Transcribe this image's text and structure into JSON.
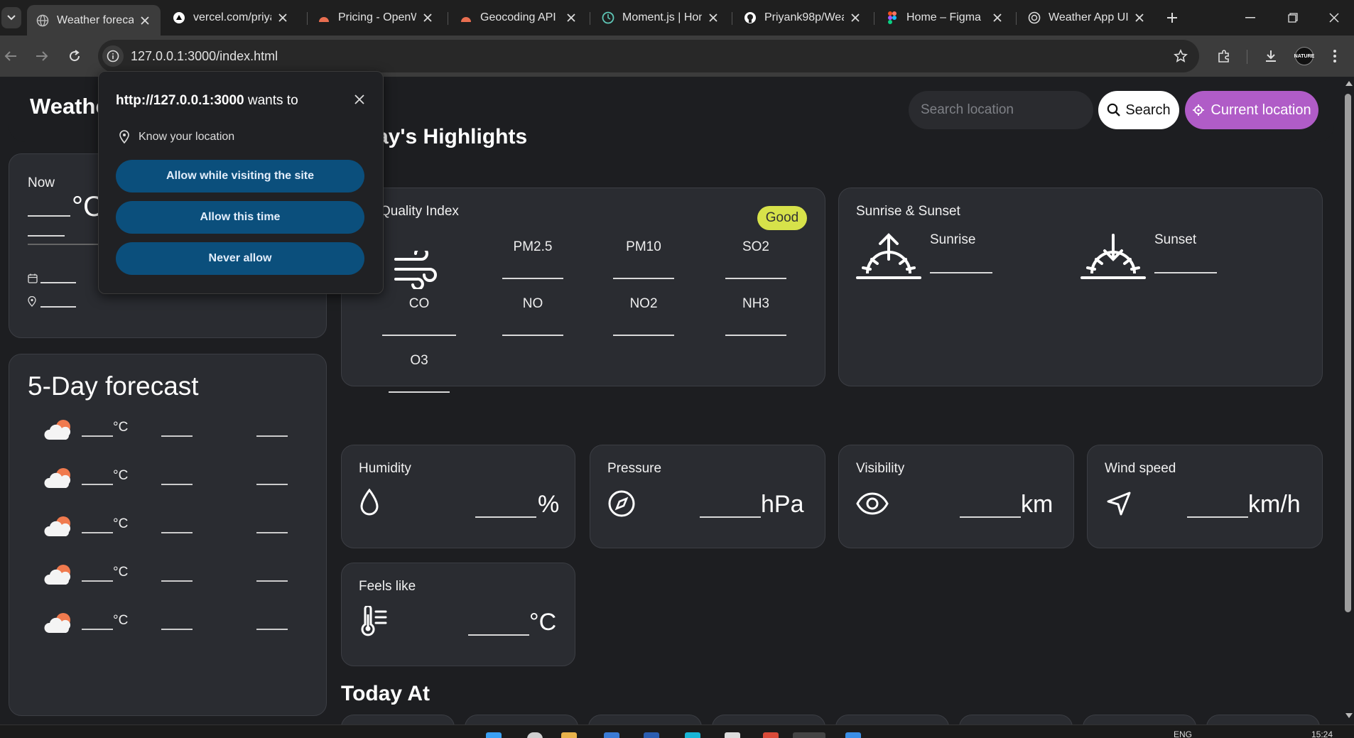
{
  "browser": {
    "tabs": [
      {
        "title": "Weather forecast",
        "active": true
      },
      {
        "title": "vercel.com/priya"
      },
      {
        "title": "Pricing - OpenW"
      },
      {
        "title": "Geocoding API -"
      },
      {
        "title": "Moment.js | Hon"
      },
      {
        "title": "Priyank98p/Wea"
      },
      {
        "title": "Home – Figma"
      },
      {
        "title": "Weather App UI"
      }
    ],
    "url": "127.0.0.1:3000/index.html",
    "profile_label": "NATURE"
  },
  "header": {
    "brand": "Weathe",
    "search_placeholder": "Search location",
    "search_label": "Search",
    "current_location_label": "Current location"
  },
  "permission_popup": {
    "origin": "http://127.0.0.1:3000",
    "suffix": " wants to",
    "request": "Know your location",
    "allow_visiting": "Allow while visiting the site",
    "allow_once": "Allow this time",
    "never": "Never allow"
  },
  "now_card": {
    "title": "Now",
    "temp_unit": "°C"
  },
  "forecast": {
    "title": "5-Day forecast",
    "rows": [
      {
        "unit": "°C"
      },
      {
        "unit": "°C"
      },
      {
        "unit": "°C"
      },
      {
        "unit": "°C"
      },
      {
        "unit": "°C"
      }
    ]
  },
  "highlights": {
    "title": "ay's Highlights",
    "aqi": {
      "title": "Quality Index",
      "badge": "Good",
      "labels": [
        "PM2.5",
        "PM10",
        "SO2",
        "CO",
        "NO",
        "NO2",
        "NH3",
        "O3"
      ]
    },
    "sun": {
      "title": "Sunrise & Sunset",
      "sunrise": "Sunrise",
      "sunset": "Sunset"
    },
    "humidity": {
      "title": "Humidity",
      "unit": "%"
    },
    "pressure": {
      "title": "Pressure",
      "unit": "hPa"
    },
    "visibility": {
      "title": "Visibility",
      "unit": "km"
    },
    "wind": {
      "title": "Wind speed",
      "unit": "km/h"
    },
    "feels": {
      "title": "Feels like",
      "unit": "°C"
    }
  },
  "today_at": {
    "title": "Today At"
  },
  "taskbar": {
    "lang": "ENG",
    "time": "15:24"
  },
  "colors": {
    "accent": "#b05cc7",
    "badge": "#d7e24a",
    "card": "#2a2c31",
    "perm_button": "#0b4f7c"
  }
}
